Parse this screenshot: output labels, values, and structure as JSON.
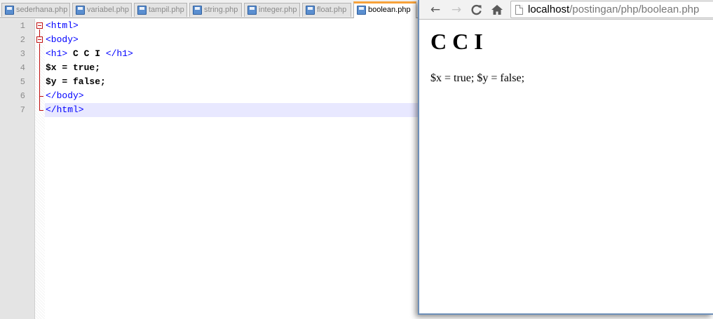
{
  "editor": {
    "tabs": [
      {
        "label": "sederhana.php",
        "active": false
      },
      {
        "label": "variabel.php",
        "active": false
      },
      {
        "label": "tampil.php",
        "active": false
      },
      {
        "label": "string.php",
        "active": false
      },
      {
        "label": "integer.php",
        "active": false
      },
      {
        "label": "float.php",
        "active": false
      },
      {
        "label": "boolean.php",
        "active": true
      }
    ],
    "tab_icon": "save-file-icon",
    "line_numbers": [
      "1",
      "2",
      "3",
      "4",
      "5",
      "6",
      "7"
    ],
    "code": {
      "line1": {
        "tag": "<html>"
      },
      "line2": {
        "tag": "<body>"
      },
      "line3": {
        "open": "<h1>",
        "text": " C C I ",
        "close": "</h1>"
      },
      "line4": {
        "text": "$x = true;"
      },
      "line5": {
        "text": "$y = false;"
      },
      "line6": {
        "tag": "</body>"
      },
      "line7": {
        "tag": "</html>"
      }
    },
    "colors": {
      "tag": "#0000ff",
      "current_line": "#e8e8ff",
      "active_tab_accent": "#f7a23a",
      "fold_marker": "#c01010"
    }
  },
  "browser": {
    "nav": {
      "back_icon": "back-arrow-icon",
      "forward_icon": "forward-arrow-icon",
      "reload_icon": "reload-icon",
      "home_icon": "home-icon"
    },
    "url": {
      "host": "localhost",
      "path": "/postingan/php/boolean.php"
    },
    "page": {
      "heading": "C C I",
      "body_text": "$x = true; $y = false;"
    }
  }
}
